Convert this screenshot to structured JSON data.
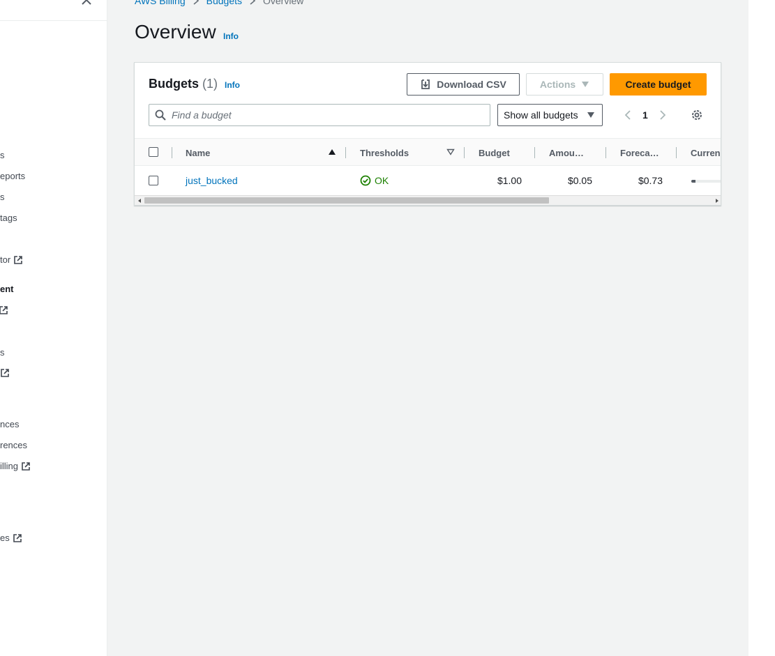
{
  "sidebar": {
    "items": [
      {
        "label": "s",
        "heading": false,
        "external": false
      },
      {
        "label": "eports",
        "heading": false,
        "external": false
      },
      {
        "label": "s",
        "heading": false,
        "external": false
      },
      {
        "label": " tags",
        "heading": false,
        "external": false
      },
      {
        "label": "tor",
        "heading": false,
        "external": true
      },
      {
        "label": "ent",
        "heading": true,
        "external": false
      },
      {
        "label": "",
        "heading": false,
        "external": true
      },
      {
        "label": "s",
        "heading": false,
        "external": false
      },
      {
        "label": "",
        "heading": false,
        "external": true
      },
      {
        "label": "nces",
        "heading": false,
        "external": false
      },
      {
        "label": "rences",
        "heading": false,
        "external": false
      },
      {
        "label": "illing",
        "heading": false,
        "external": true
      },
      {
        "label": "es",
        "heading": false,
        "external": true
      }
    ]
  },
  "breadcrumb": {
    "items": [
      "AWS Billing",
      "Budgets"
    ],
    "current": "Overview"
  },
  "page": {
    "title": "Overview",
    "info": "Info"
  },
  "budgets_panel": {
    "title": "Budgets",
    "count": "(1)",
    "info": "Info",
    "download_label": "Download CSV",
    "actions_label": "Actions",
    "create_label": "Create budget",
    "search_placeholder": "Find a budget",
    "filter_value": "Show all budgets",
    "page_number": "1"
  },
  "table": {
    "columns": {
      "name": "Name",
      "thresholds": "Thresholds",
      "budget": "Budget",
      "amount": "Amou…",
      "forecast": "Foreca…",
      "current": "Curren"
    },
    "rows": [
      {
        "name": "just_bucked",
        "thresholds": "OK",
        "budget": "$1.00",
        "amount": "$0.05",
        "forecast": "$0.73",
        "current_progress": 0.05
      }
    ]
  },
  "colors": {
    "link": "#0073bb",
    "primary": "#ff9900",
    "ok": "#1d8102",
    "page_bg": "#f2f3f3"
  }
}
